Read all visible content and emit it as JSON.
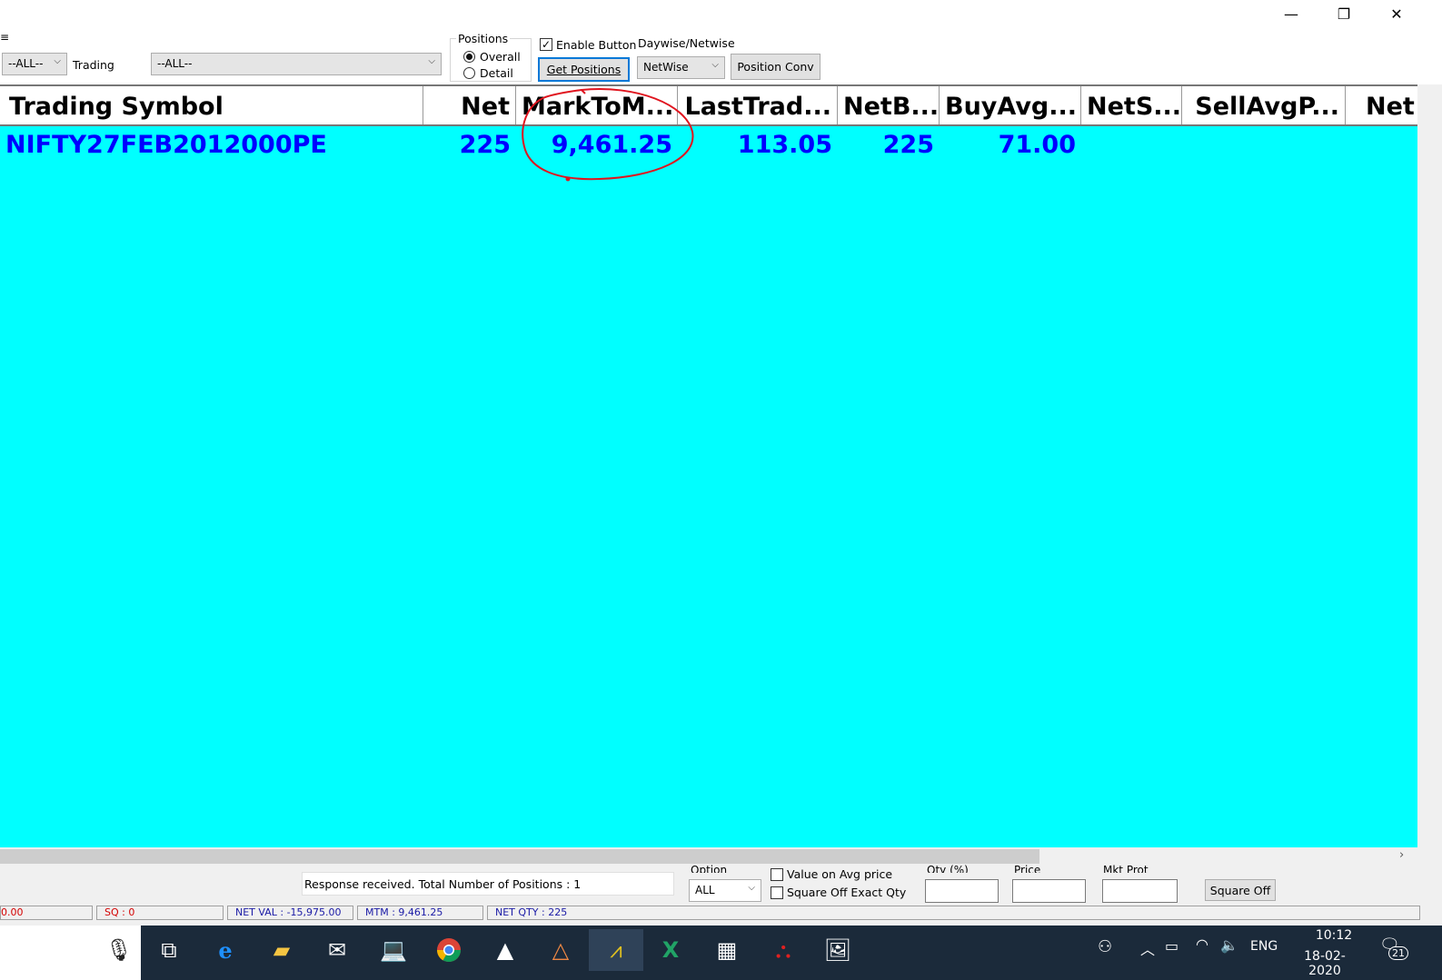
{
  "window": {
    "minimize_glyph": "—",
    "restore_glyph": "❐",
    "close_glyph": "✕",
    "menu_glyph": "≡"
  },
  "toolbar": {
    "exchange_select": "--ALL--",
    "trading_label": "Trading",
    "trading_select": "--ALL--",
    "positions_group_label": "Positions",
    "radio_overall": "Overall",
    "radio_detail": "Detail",
    "enable_button_label": "Enable Button",
    "get_positions": "Get Positions",
    "daywise_label": "Daywise/Netwise",
    "netwise_select": "NetWise",
    "position_conv": "Position Conv"
  },
  "grid": {
    "columns": [
      "Trading Symbol",
      "Net",
      "MarkToM...",
      "LastTrad...",
      "NetB...",
      "BuyAvg...",
      "NetS...",
      "SellAvgP...",
      "Net"
    ],
    "rows": [
      {
        "symbol": "NIFTY27FEB2012000PE",
        "net": "225",
        "mtm": "9,461.25",
        "ltp": "113.05",
        "netbuy": "225",
        "buyavg": "71.00"
      }
    ],
    "row_bg": "#00ffff",
    "row_text_color": "#0000ff",
    "annotation_color": "#e0141e"
  },
  "bottom": {
    "response_text": "Response received. Total Number of Positions : 1",
    "option_label": "Option",
    "option_select": "ALL",
    "value_on_avg": "Value on Avg  price",
    "square_off_exact": "Square Off Exact Qty",
    "qty_label": "Qty (%)",
    "price_label": "Price",
    "mkt_prot_label": "Mkt Prot",
    "square_off_button": "Square Off"
  },
  "statusbar": {
    "val": "0.00",
    "sq": "SQ : 0",
    "net_val": "NET VAL : -15,975.00",
    "mtm": "MTM : 9,461.25",
    "net_qty": "NET QTY : 225"
  },
  "taskbar": {
    "language": "ENG",
    "time": "10:12",
    "date": "18-02-2020",
    "notification_count": "21"
  }
}
